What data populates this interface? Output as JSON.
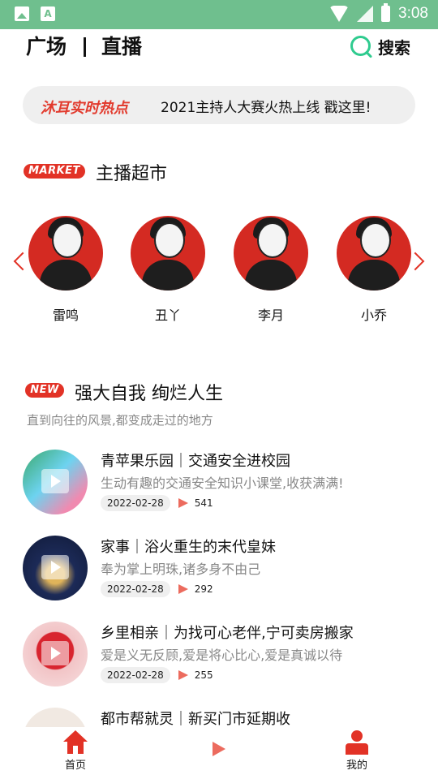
{
  "status_bar": {
    "time": "3:08",
    "icons": [
      "image-icon",
      "a-icon",
      "wifi-icon",
      "signal-off-icon",
      "battery-icon"
    ]
  },
  "header": {
    "tab_square": "广场",
    "tab_live": "直播",
    "search_label": "搜索"
  },
  "hot_banner": {
    "tag": "沐耳实时热点",
    "text": "2021主持人大赛火热上线 戳这里!"
  },
  "market": {
    "badge": "MARKET",
    "title": "主播超市",
    "hosts": [
      {
        "name": "雷鸣"
      },
      {
        "name": "丑丫"
      },
      {
        "name": "李月"
      },
      {
        "name": "小乔"
      }
    ]
  },
  "featured": {
    "badge": "NEW",
    "title": "强大自我 绚烂人生",
    "subtitle": "直到向往的风景,都变成走过的地方",
    "items": [
      {
        "title": "青苹果乐园｜交通安全进校园",
        "desc": "生动有趣的交通安全知识小课堂,收获满满!",
        "date": "2022-02-28",
        "views": "541"
      },
      {
        "title": "家事｜浴火重生的末代皇妹",
        "desc": "奉为掌上明珠,诸多身不由己",
        "date": "2022-02-28",
        "views": "292"
      },
      {
        "title": "乡里相亲｜为找可心老伴,宁可卖房搬家",
        "desc": "爱是义无反顾,爱是将心比心,爱是真诚以待",
        "date": "2022-02-28",
        "views": "255"
      },
      {
        "title": "都市帮就灵｜新买门市延期收",
        "desc": "",
        "date": "",
        "views": ""
      }
    ]
  },
  "bottom_nav": {
    "home": "首页",
    "mine": "我的"
  },
  "colors": {
    "status_bar": "#6fbf8e",
    "accent_red": "#e23226",
    "search_green": "#2fcb8f"
  }
}
